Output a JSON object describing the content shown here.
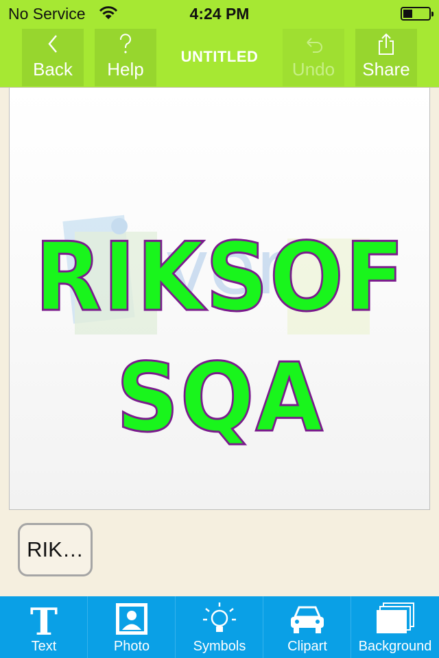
{
  "status": {
    "carrier": "No Service",
    "time": "4:24 PM",
    "icons": [
      "wifi-icon",
      "battery-icon"
    ]
  },
  "nav": {
    "back": {
      "label": "Back",
      "icon": "chevron-left-icon"
    },
    "help": {
      "label": "Help",
      "icon": "question-icon"
    },
    "title": "UNTITLED",
    "undo": {
      "label": "Undo",
      "icon": "undo-icon",
      "enabled": false
    },
    "share": {
      "label": "Share",
      "icon": "share-icon"
    }
  },
  "canvas": {
    "line1": "RIKSOF",
    "line2": "SQA",
    "text_fill": "#19f51c",
    "text_stroke": "#7a1a8c"
  },
  "text_chip": {
    "label": "RIK…"
  },
  "toolbar": {
    "items": [
      {
        "label": "Text",
        "icon": "text-icon"
      },
      {
        "label": "Photo",
        "icon": "photo-icon"
      },
      {
        "label": "Symbols",
        "icon": "lightbulb-icon"
      },
      {
        "label": "Clipart",
        "icon": "car-icon"
      },
      {
        "label": "Background",
        "icon": "layers-icon"
      }
    ]
  },
  "colors": {
    "header": "#a6e833",
    "toolbar": "#0aa0e6",
    "page_bg": "#f5efdf"
  }
}
